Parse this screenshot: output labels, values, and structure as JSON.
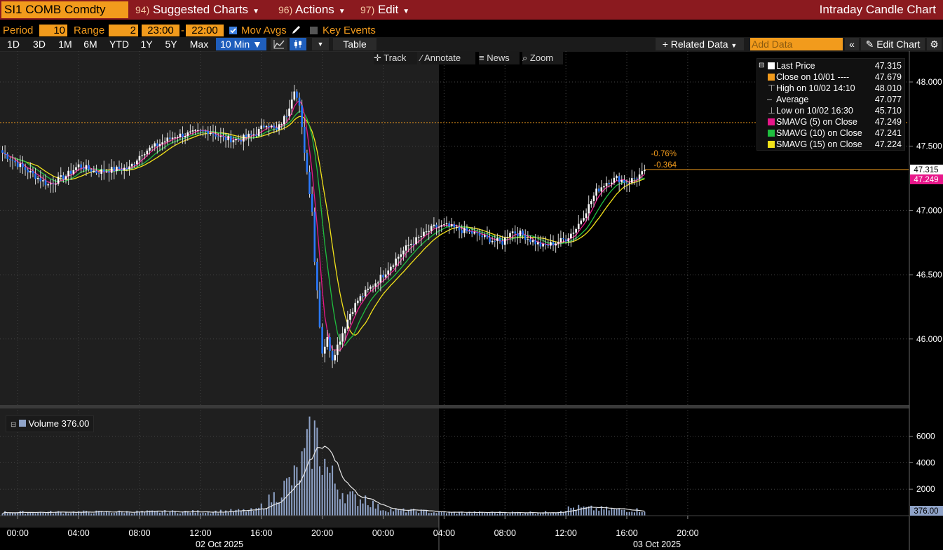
{
  "header": {
    "ticker": "SI1 COMB Comdty",
    "menus": [
      {
        "num": "94)",
        "label": "Suggested Charts"
      },
      {
        "num": "96)",
        "label": "Actions"
      },
      {
        "num": "97)",
        "label": "Edit"
      }
    ],
    "chart_title": "Intraday Candle Chart"
  },
  "settings": {
    "period_label": "Period",
    "period_value": "10",
    "range_label": "Range",
    "range_value": "2",
    "time_from": "23:00",
    "time_sep": "-",
    "time_to": "22:00",
    "mov_avgs_label": "Mov Avgs",
    "key_events_label": "Key Events"
  },
  "toolbar": {
    "ranges": [
      "1D",
      "3D",
      "1M",
      "6M",
      "YTD",
      "1Y",
      "5Y",
      "Max"
    ],
    "interval": "10 Min",
    "table_label": "Table",
    "related_data": "Related Data",
    "add_data_placeholder": "Add Data",
    "edit_chart": "Edit Chart"
  },
  "chart_tools": {
    "track": "Track",
    "annotate": "Annotate",
    "news": "News",
    "zoom": "Zoom"
  },
  "legend": [
    {
      "label": "Last Price",
      "value": "47.315",
      "color": "#ffffff"
    },
    {
      "label": "Close on 10/01 ----",
      "value": "47.679",
      "color": "#f29b1c"
    },
    {
      "label": "High on 10/02 14:10",
      "value": "48.010",
      "color": ""
    },
    {
      "label": "Average",
      "value": "47.077",
      "color": ""
    },
    {
      "label": "Low on 10/02 16:30",
      "value": "45.710",
      "color": ""
    },
    {
      "label": "SMAVG (5)   on Close",
      "value": "47.249",
      "color": "#e8178a"
    },
    {
      "label": "SMAVG (10)  on Close",
      "value": "47.241",
      "color": "#1fbf3f"
    },
    {
      "label": "SMAVG (15)  on Close",
      "value": "47.224",
      "color": "#f2e21a"
    }
  ],
  "annotations": {
    "pct_change": "-0.76%",
    "abs_change": "-0.364",
    "last_flag": "47.315",
    "sma_flag": "47.249",
    "vol_flag": "376.00"
  },
  "volume_legend": "Volume 376.00",
  "chart_data": {
    "type": "candlestick",
    "price_axis": {
      "ticks": [
        "48.000",
        "47.500",
        "47.000",
        "46.500",
        "46.000"
      ],
      "range": [
        45.5,
        48.3
      ]
    },
    "volume_axis": {
      "ticks": [
        "6000",
        "4000",
        "2000"
      ],
      "range": [
        0,
        7300
      ]
    },
    "x_ticks": [
      "00:00",
      "04:00",
      "08:00",
      "12:00",
      "16:00",
      "20:00",
      "00:00",
      "04:00",
      "08:00",
      "12:00",
      "16:00",
      "20:00"
    ],
    "date_labels": [
      "02 Oct 2025",
      "03 Oct 2025"
    ],
    "prior_close": 47.679,
    "last_price": 47.315,
    "price_anchors": [
      [
        0,
        47.45
      ],
      [
        6,
        47.36
      ],
      [
        12,
        47.28
      ],
      [
        18,
        47.2
      ],
      [
        25,
        47.27
      ],
      [
        30,
        47.35
      ],
      [
        37,
        47.3
      ],
      [
        44,
        47.32
      ],
      [
        50,
        47.33
      ],
      [
        55,
        47.45
      ],
      [
        62,
        47.52
      ],
      [
        68,
        47.58
      ],
      [
        75,
        47.6
      ],
      [
        81,
        47.62
      ],
      [
        87,
        47.56
      ],
      [
        93,
        47.55
      ],
      [
        100,
        47.6
      ],
      [
        104,
        47.68
      ],
      [
        108,
        47.62
      ],
      [
        112,
        47.75
      ],
      [
        115,
        47.95
      ],
      [
        117,
        47.8
      ],
      [
        120,
        47.3
      ],
      [
        122,
        47.0
      ],
      [
        123,
        46.6
      ],
      [
        124,
        46.4
      ],
      [
        125,
        46.1
      ],
      [
        126,
        45.9
      ],
      [
        128,
        46.0
      ],
      [
        130,
        45.85
      ],
      [
        132,
        45.95
      ],
      [
        134,
        46.05
      ],
      [
        137,
        46.2
      ],
      [
        140,
        46.3
      ],
      [
        145,
        46.4
      ],
      [
        150,
        46.5
      ],
      [
        155,
        46.62
      ],
      [
        160,
        46.73
      ],
      [
        165,
        46.8
      ],
      [
        170,
        46.87
      ],
      [
        175,
        46.88
      ],
      [
        180,
        46.85
      ],
      [
        186,
        46.82
      ],
      [
        191,
        46.78
      ],
      [
        197,
        46.75
      ],
      [
        200,
        46.84
      ],
      [
        204,
        46.82
      ],
      [
        208,
        46.77
      ],
      [
        213,
        46.72
      ],
      [
        218,
        46.75
      ],
      [
        222,
        46.78
      ],
      [
        226,
        46.86
      ],
      [
        230,
        47.0
      ],
      [
        234,
        47.15
      ],
      [
        238,
        47.22
      ],
      [
        242,
        47.25
      ],
      [
        246,
        47.22
      ],
      [
        250,
        47.26
      ],
      [
        253,
        47.3
      ]
    ],
    "volume_anchors": [
      [
        0,
        250
      ],
      [
        40,
        280
      ],
      [
        80,
        300
      ],
      [
        100,
        400
      ],
      [
        104,
        1000
      ],
      [
        108,
        1600
      ],
      [
        112,
        2300
      ],
      [
        116,
        3000
      ],
      [
        119,
        4200
      ],
      [
        121,
        5300
      ],
      [
        123,
        5900
      ],
      [
        125,
        5000
      ],
      [
        127,
        4000
      ],
      [
        129,
        3100
      ],
      [
        131,
        2500
      ],
      [
        133,
        2000
      ],
      [
        136,
        1500
      ],
      [
        140,
        1200
      ],
      [
        143,
        1400
      ],
      [
        147,
        700
      ],
      [
        150,
        500
      ],
      [
        155,
        400
      ],
      [
        165,
        350
      ],
      [
        170,
        250
      ],
      [
        190,
        230
      ],
      [
        215,
        250
      ],
      [
        225,
        600
      ],
      [
        235,
        500
      ],
      [
        253,
        400
      ]
    ]
  },
  "colors": {
    "up_candle": "#ffffff",
    "down_candle": "#2a79ff",
    "volume": "#8fa3c8",
    "accent": "#f29b1c",
    "header_bg": "#8b1a1f"
  }
}
